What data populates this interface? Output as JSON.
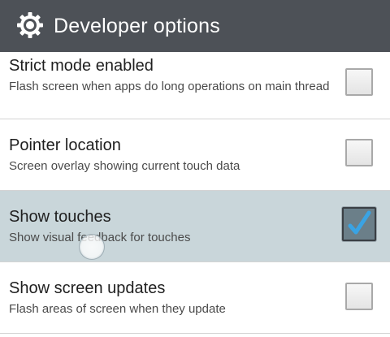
{
  "header": {
    "title": "Developer options",
    "icon": "gear-icon"
  },
  "settings": [
    {
      "title": "Strict mode enabled",
      "summary": "Flash screen when apps do long operations on main thread",
      "checked": false
    },
    {
      "title": "Pointer location",
      "summary": "Screen overlay showing current touch data",
      "checked": false
    },
    {
      "title": "Show touches",
      "summary": "Show visual feedback for touches",
      "checked": true,
      "highlighted": true
    },
    {
      "title": "Show screen updates",
      "summary": "Flash areas of screen when they update",
      "checked": false
    }
  ],
  "colors": {
    "header_bg": "#4d5157",
    "highlight_bg": "#c9d6da",
    "check_accent": "#3aa3e3"
  }
}
